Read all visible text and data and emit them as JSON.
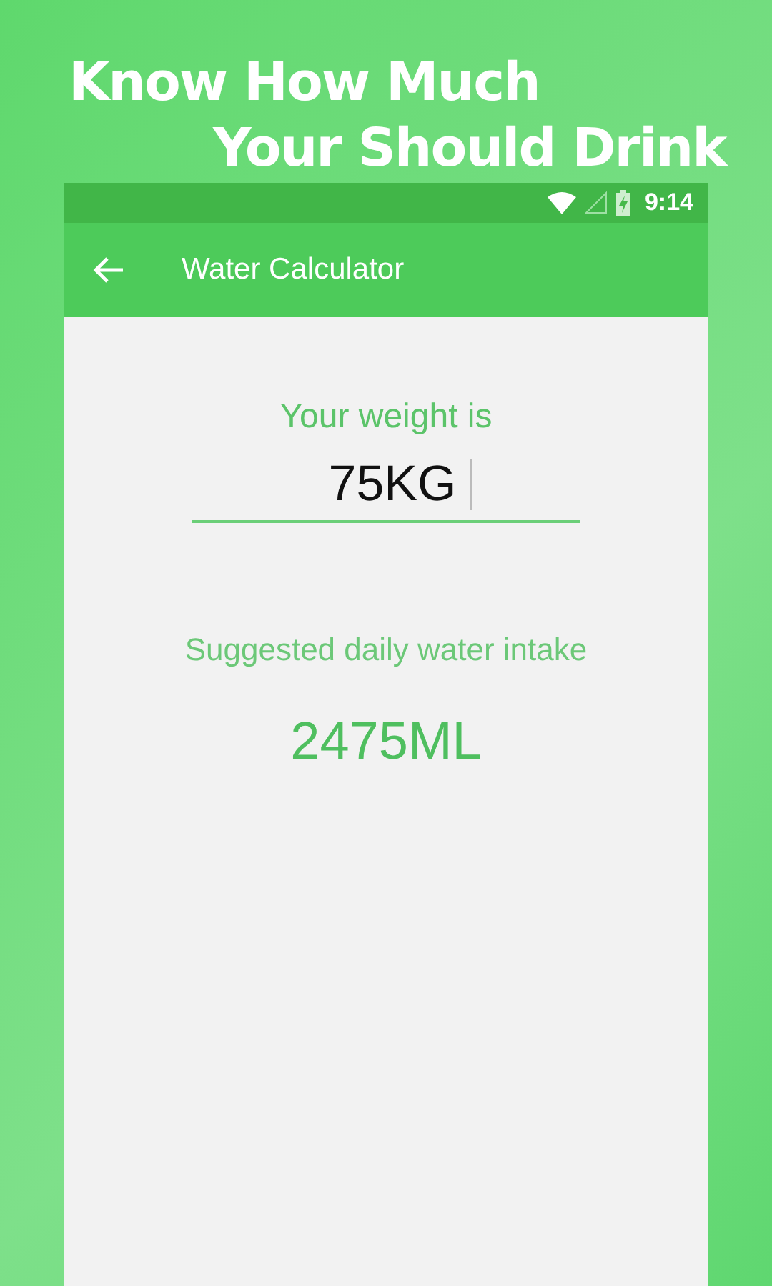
{
  "headline": [
    "Know How Much",
    "Your Should Drink"
  ],
  "status_bar": {
    "time": "9:14"
  },
  "app_bar": {
    "title": "Water Calculator"
  },
  "weight": {
    "label": "Your weight is",
    "value": "75KG"
  },
  "result": {
    "label": "Suggested daily water intake",
    "value": "2475ML"
  }
}
